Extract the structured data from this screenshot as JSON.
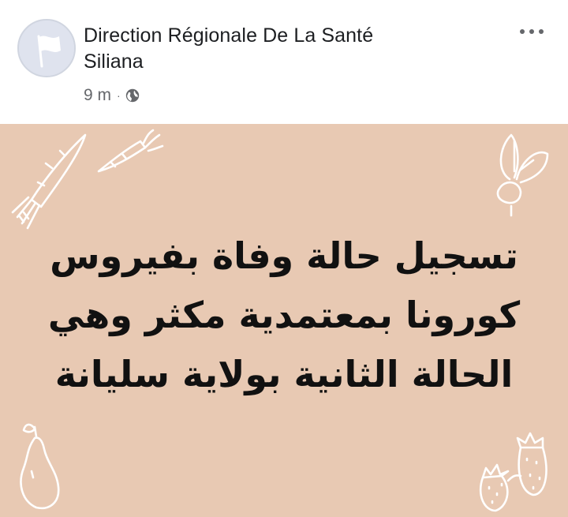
{
  "post": {
    "author": {
      "name_line1": "Direction Régionale De La Santé",
      "name_line2": "Siliana",
      "avatar_icon": "white-flag-icon"
    },
    "meta": {
      "time": "9 m",
      "separator": "·",
      "audience_icon": "globe-icon"
    },
    "more_icon": "more-dots-icon"
  },
  "image": {
    "background_color": "#e8c9b3",
    "lines": [
      "تسجيل  حالة وفاة بفيروس",
      "كورونا بمعتمدية مكثر وهي",
      "الحالة الثانية بولاية سليانة"
    ],
    "decorations": [
      "carrot-icon",
      "carrot-icon",
      "beet-icon",
      "pear-icon",
      "strawberry-icon",
      "strawberry-icon"
    ]
  }
}
